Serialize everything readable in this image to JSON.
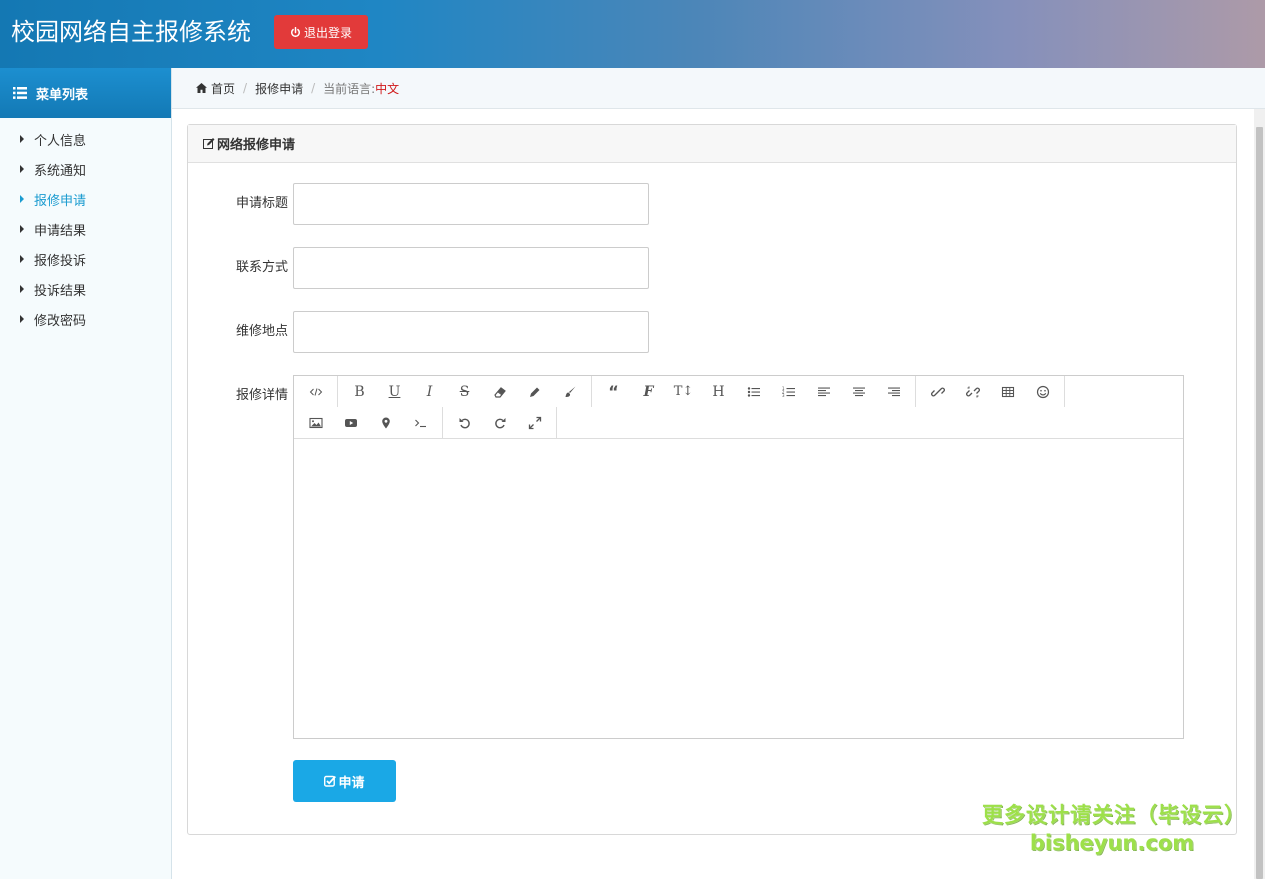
{
  "header": {
    "title": "校园网络自主报修系统",
    "logout_label": "退出登录",
    "logout_icon": "power-icon"
  },
  "sidebar": {
    "title": "菜单列表",
    "title_icon": "list-icon",
    "items": [
      {
        "label": "个人信息",
        "active": false
      },
      {
        "label": "系统通知",
        "active": false
      },
      {
        "label": "报修申请",
        "active": true
      },
      {
        "label": "申请结果",
        "active": false
      },
      {
        "label": "报修投诉",
        "active": false
      },
      {
        "label": "投诉结果",
        "active": false
      },
      {
        "label": "修改密码",
        "active": false
      }
    ]
  },
  "breadcrumb": {
    "home": "首页",
    "current": "报修申请",
    "lang_label": "当前语言:",
    "lang_value": "中文"
  },
  "panel": {
    "title": "网络报修申请",
    "title_icon": "edit-icon"
  },
  "form": {
    "title_label": "申请标题",
    "title_value": "",
    "contact_label": "联系方式",
    "contact_value": "",
    "location_label": "维修地点",
    "location_value": "",
    "details_label": "报修详情",
    "details_value": "",
    "submit_label": "申请",
    "submit_icon": "check-square-icon"
  },
  "editor_toolbar": {
    "row1": [
      [
        "code-view-icon"
      ],
      [
        "bold-icon",
        "underline-icon",
        "italic-icon",
        "strikethrough-icon",
        "eraser-icon",
        "pencil-icon",
        "brush-icon"
      ],
      [
        "quote-icon",
        "font-icon",
        "text-height-icon",
        "heading-icon",
        "unordered-list-icon",
        "ordered-list-icon",
        "align-left-icon",
        "align-center-icon",
        "align-right-icon"
      ],
      [
        "link-icon",
        "unlink-icon",
        "table-icon",
        "emoji-icon"
      ]
    ],
    "row2": [
      [
        "image-icon",
        "video-icon",
        "location-icon",
        "terminal-icon"
      ],
      [
        "undo-icon",
        "redo-icon",
        "fullscreen-icon"
      ]
    ]
  },
  "watermark": {
    "line1": "更多设计请关注（毕设云）",
    "line2": "bisheyun.com"
  },
  "colors": {
    "accent": "#1aa8e6",
    "danger": "#e23a3a",
    "active_menu": "#1a9bd0",
    "lang_red": "#d0191a"
  }
}
